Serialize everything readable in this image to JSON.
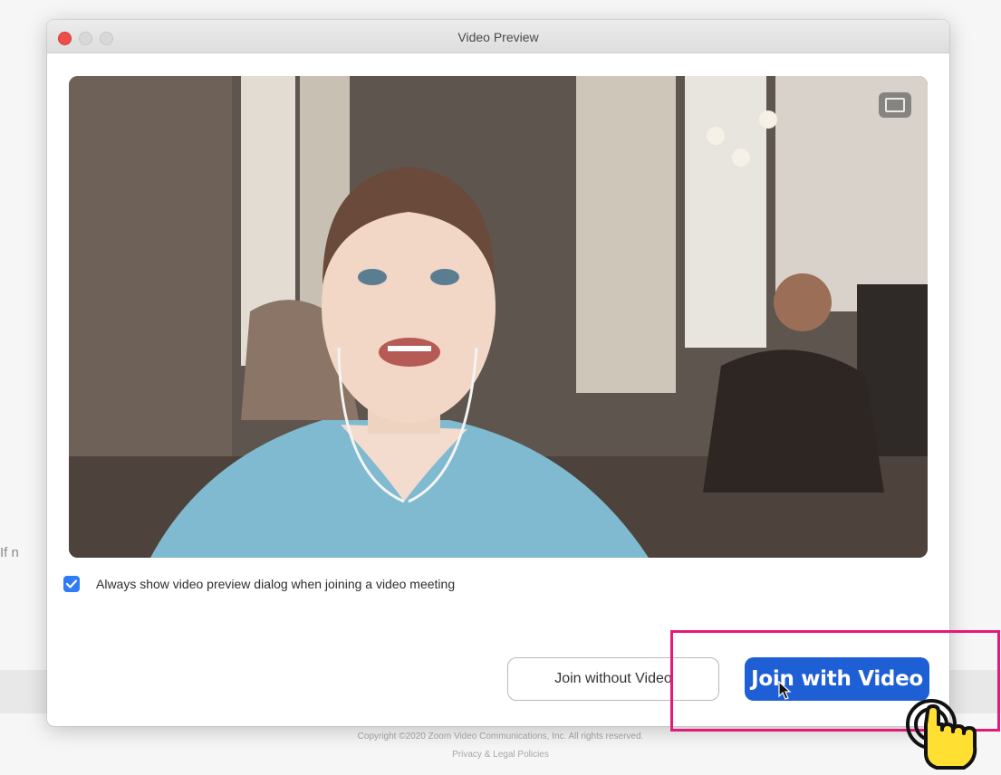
{
  "background": {
    "partial_text": "If n",
    "footer_line1": "Copyright ©2020 Zoom Video Communications, Inc. All rights reserved.",
    "footer_line2": "Privacy & Legal Policies"
  },
  "dialog": {
    "title": "Video Preview",
    "checkbox_label": "Always show video preview dialog when joining a video meeting",
    "checkbox_checked": true,
    "buttons": {
      "join_without_video": "Join without Video",
      "join_with_video": "Join with Video"
    },
    "icons": {
      "close": "close-icon",
      "minimize": "minimize-icon",
      "zoom": "zoom-icon",
      "video_toggle": "video-toggle-icon",
      "checkmark": "checkmark-icon",
      "cursor": "pointer-cursor-icon",
      "hand": "hand-tap-icon"
    }
  },
  "colors": {
    "primary_button": "#1f5fd6",
    "checkbox": "#2e7cf6",
    "highlight": "#e6197a",
    "close_light": "#ee4d4a"
  }
}
